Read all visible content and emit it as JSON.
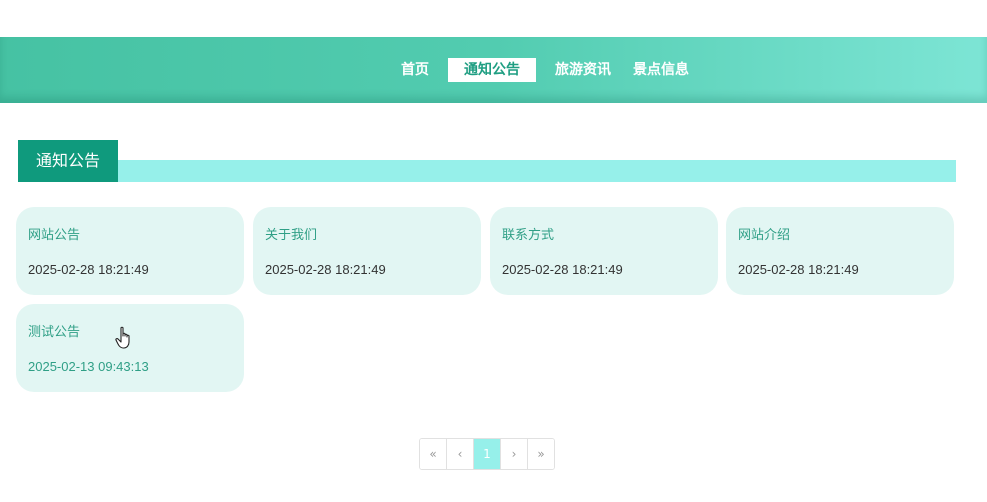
{
  "nav": {
    "items": [
      {
        "label": "首页",
        "active": false
      },
      {
        "label": "通知公告",
        "active": true
      },
      {
        "label": "旅游资讯",
        "active": false
      },
      {
        "label": "景点信息",
        "active": false
      }
    ]
  },
  "section": {
    "title": "通知公告"
  },
  "notices": [
    {
      "title": "网站公告",
      "date": "2025-02-28 18:21:49"
    },
    {
      "title": "关于我们",
      "date": "2025-02-28 18:21:49"
    },
    {
      "title": "联系方式",
      "date": "2025-02-28 18:21:49"
    },
    {
      "title": "网站介绍",
      "date": "2025-02-28 18:21:49"
    },
    {
      "title": "测试公告",
      "date": "2025-02-13 09:43:13"
    }
  ],
  "pagination": {
    "first": "«",
    "prev": "‹",
    "current": "1",
    "next": "›",
    "last": "»"
  },
  "colors": {
    "accent": "#0f9a7d",
    "accent_light": "#96f0ea",
    "card_bg": "#e2f6f3",
    "text_green": "#2f9f86"
  }
}
